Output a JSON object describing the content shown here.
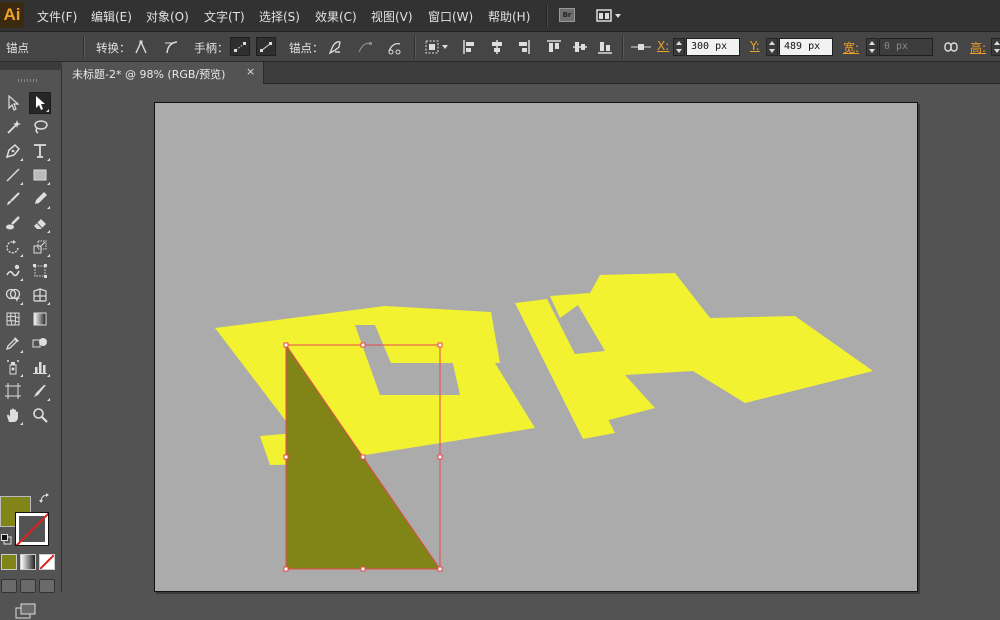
{
  "app": {
    "logo": "Ai"
  },
  "menu": {
    "items": [
      "文件(F)",
      "编辑(E)",
      "对象(O)",
      "文字(T)",
      "选择(S)",
      "效果(C)",
      "视图(V)",
      "窗口(W)",
      "帮助(H)"
    ],
    "bridge_label": "Br"
  },
  "control_bar": {
    "selection_label": "锚点",
    "convert_label": "转换：",
    "handles_label": "手柄：",
    "anchors_label": "锚点：",
    "x_label": "X:",
    "x_value": "300 px",
    "y_label": "Y:",
    "y_value": "489 px",
    "width_label": "宽:",
    "width_value": "0 px",
    "height_label": "高:"
  },
  "document": {
    "tab_title": "未标题-2* @ 98% (RGB/预览)",
    "close_glyph": "×"
  },
  "colors": {
    "fill": "#818517",
    "text_art": "#f3f230",
    "selection": "#e8474f",
    "artboard": "#ababab"
  },
  "tools": [
    "selection-tool",
    "direct-selection-tool",
    "magic-wand-tool",
    "lasso-tool",
    "pen-tool",
    "type-tool",
    "line-segment-tool",
    "rectangle-tool",
    "paintbrush-tool",
    "pencil-tool",
    "blob-brush-tool",
    "eraser-tool",
    "rotate-tool",
    "scale-tool",
    "warp-tool",
    "free-transform-tool",
    "shape-builder-tool",
    "perspective-grid-tool",
    "mesh-tool",
    "gradient-tool",
    "eyedropper-tool",
    "blend-tool",
    "symbol-sprayer-tool",
    "column-graph-tool",
    "artboard-tool",
    "slice-tool",
    "hand-tool",
    "zoom-tool"
  ]
}
